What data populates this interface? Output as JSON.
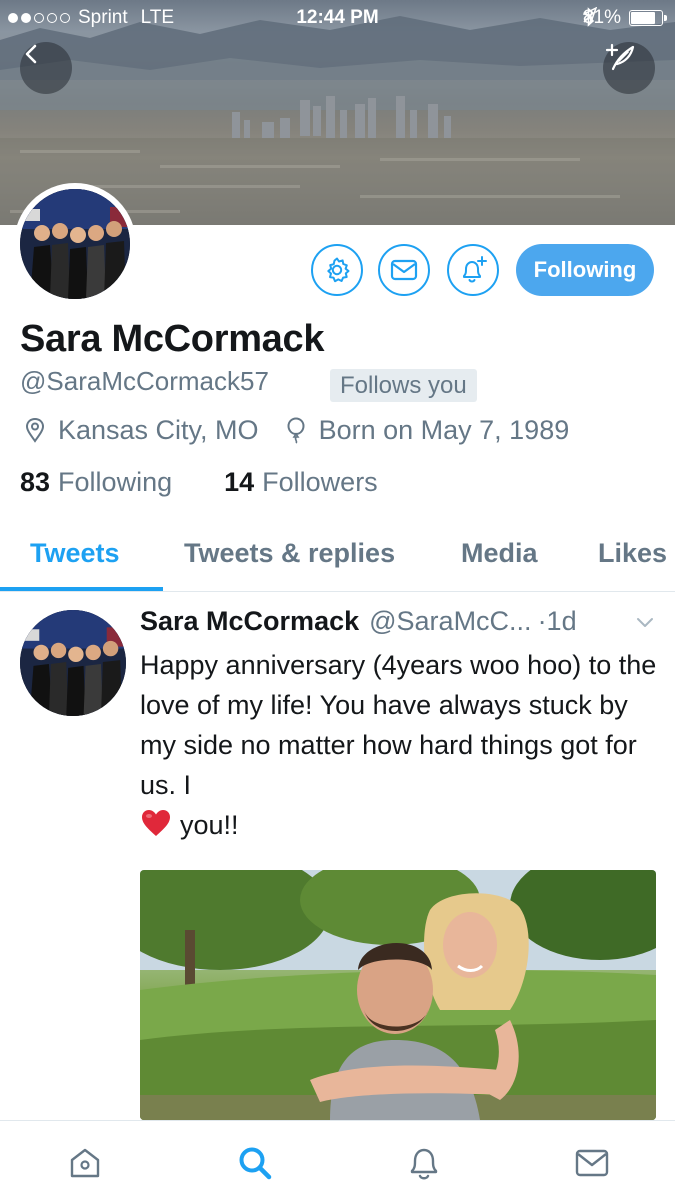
{
  "status_bar": {
    "carrier": "Sprint",
    "network": "LTE",
    "time": "12:44 PM",
    "battery": "81%",
    "battery_level": 0.81
  },
  "profile": {
    "name": "Sara McCormack",
    "handle": "@SaraMcCormack57",
    "follows_you_badge": "Follows you",
    "location": "Kansas City, MO",
    "birthday": "Born on May 7, 1989",
    "following_count": "83",
    "following_label": "Following",
    "followers_count": "14",
    "followers_label": "Followers",
    "follow_button_label": "Following"
  },
  "tabs": [
    {
      "label": "Tweets",
      "active": true
    },
    {
      "label": "Tweets & replies",
      "active": false
    },
    {
      "label": "Media",
      "active": false
    },
    {
      "label": "Likes",
      "active": false
    }
  ],
  "tweet": {
    "author_name": "Sara McCormack",
    "author_handle": "@SaraMcC...",
    "time": "·1d",
    "text": "Happy anniversary (4years woo hoo) to the love of my life! You have always stuck by my side no matter how hard things got for us. I",
    "text_end": "you!!",
    "emoji": "red-heart"
  },
  "icons": {
    "back": "chevron-left-icon",
    "compose": "compose-tweet-icon",
    "settings": "gear-icon",
    "dm": "envelope-icon",
    "notify": "bell-plus-icon",
    "location": "location-pin-icon",
    "birthday": "balloon-icon",
    "nav": [
      "home-icon",
      "search-icon",
      "bell-icon",
      "envelope-icon"
    ]
  },
  "colors": {
    "accent": "#1da1f2",
    "follow_button": "#4ca7ee",
    "secondary_text": "#657786",
    "primary_text": "#14171a"
  }
}
